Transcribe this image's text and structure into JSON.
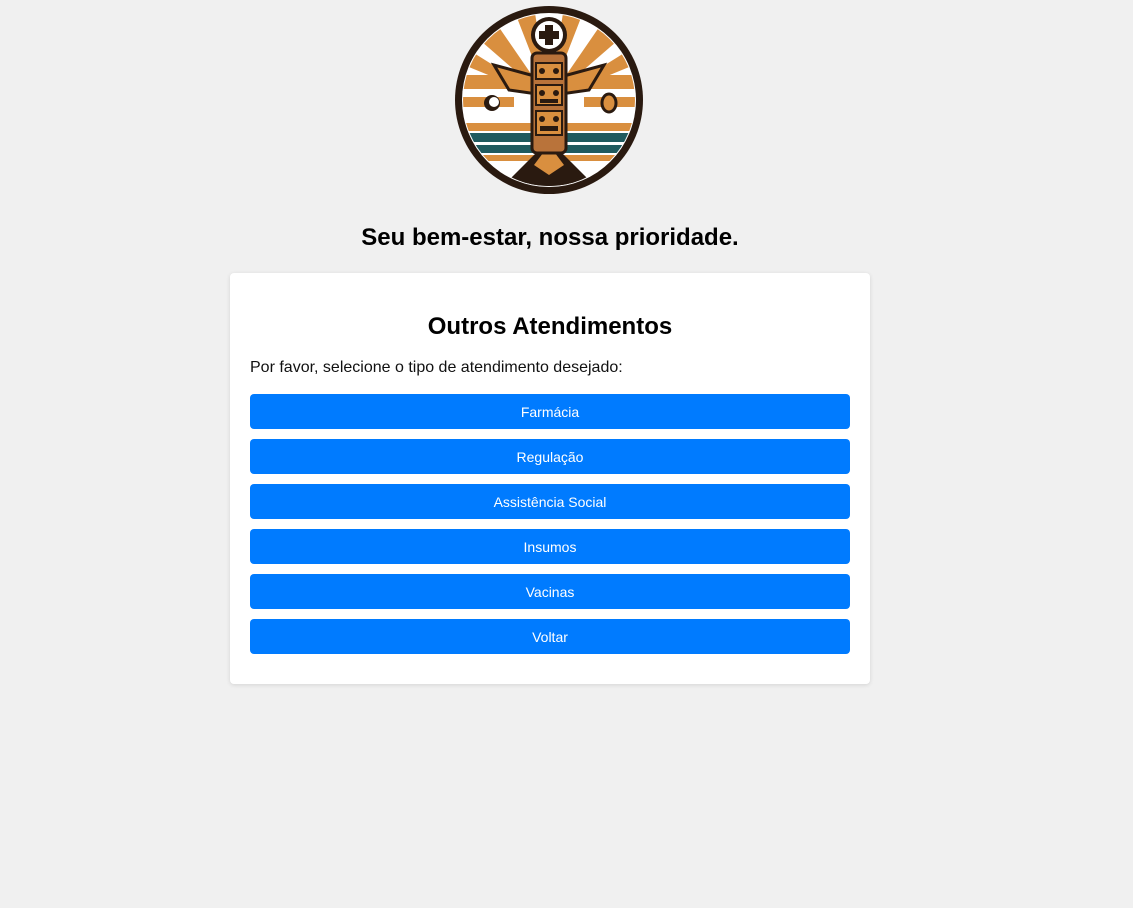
{
  "header": {
    "tagline": "Seu bem-estar, nossa prioridade.",
    "logo_icon": "totem-medical-cross-logo"
  },
  "card": {
    "title": "Outros Atendimentos",
    "subtitle": "Por favor, selecione o tipo de atendimento desejado:",
    "buttons": [
      {
        "label": "Farmácia"
      },
      {
        "label": "Regulação"
      },
      {
        "label": "Assistência Social"
      },
      {
        "label": "Insumos"
      },
      {
        "label": "Vacinas"
      },
      {
        "label": "Voltar"
      }
    ]
  },
  "colors": {
    "background": "#f0f0f0",
    "card": "#ffffff",
    "button": "#007bff",
    "button_text": "#ffffff",
    "logo_orange": "#d98f3f",
    "logo_dark": "#2a1a10",
    "logo_teal": "#1f5a5e"
  }
}
